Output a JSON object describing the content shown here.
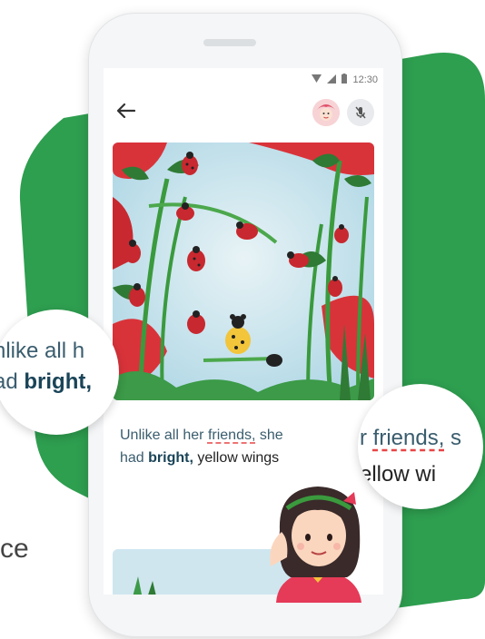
{
  "left_caption": "ce",
  "status_bar": {
    "time": "12:30"
  },
  "story": {
    "prefix": "Unlike all her ",
    "misread_word": "friends,",
    "mid": " she",
    "line2_prefix": "had ",
    "emphasis_word": "bright,",
    "suffix": " yellow wings"
  },
  "zoom_left": {
    "line1": "nlike all h",
    "line2_prefix": "ad ",
    "line2_emphasis": "bright,"
  },
  "zoom_right": {
    "line1_prefix": "r ",
    "line1_misread": "friends,",
    "line1_suffix": " s",
    "line2": "ellow wi"
  },
  "icons": [
    "back-arrow-icon",
    "avatar-icon",
    "mic-off-icon",
    "wifi-icon",
    "signal-icon",
    "battery-icon"
  ],
  "colors": {
    "brand_green": "#2e9e4f",
    "story_blue": "#3a5d6e",
    "emphasis_blue": "#1a4458",
    "error_red": "#e84545"
  }
}
